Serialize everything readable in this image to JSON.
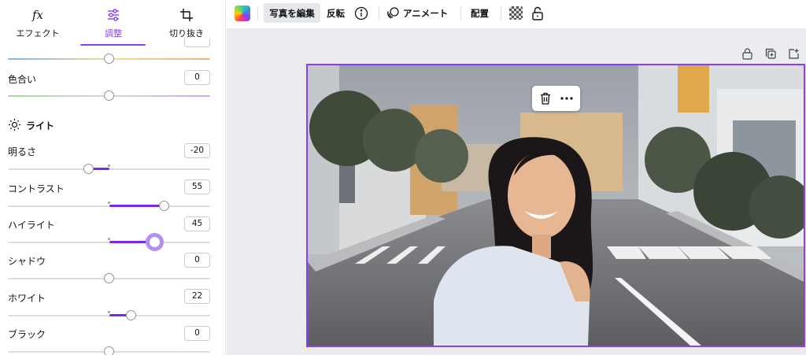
{
  "tabs": [
    {
      "label": "エフェクト",
      "icon": "fx-icon"
    },
    {
      "label": "調整",
      "icon": "adjust-sliders-icon"
    },
    {
      "label": "切り抜き",
      "icon": "crop-icon"
    }
  ],
  "adjust": {
    "top_partial_value": "",
    "tint": {
      "label": "色合い",
      "value": "0"
    },
    "light_section": {
      "title": "ライト",
      "icon": "sun-icon"
    },
    "brightness": {
      "label": "明るさ",
      "value": "-20"
    },
    "contrast": {
      "label": "コントラスト",
      "value": "55"
    },
    "highlights": {
      "label": "ハイライト",
      "value": "45"
    },
    "shadows": {
      "label": "シャドウ",
      "value": "0"
    },
    "whites": {
      "label": "ホワイト",
      "value": "22"
    },
    "blacks": {
      "label": "ブラック",
      "value": "0"
    }
  },
  "toolbar": {
    "edit_photo": "写真を編集",
    "flip": "反転",
    "animate": "アニメート",
    "position": "配置",
    "icons": [
      "color-swatch-icon",
      "info-icon",
      "animate-icon",
      "transparency-icon",
      "lock-icon"
    ]
  },
  "canvas": {
    "corner_icons": [
      "lock-icon",
      "duplicate-icon",
      "add-page-icon"
    ],
    "float_menu_icons": [
      "trash-icon",
      "more-icon"
    ],
    "colors": {
      "accent": "#8b3dff",
      "slider_fill": "#7d2ae8"
    }
  }
}
